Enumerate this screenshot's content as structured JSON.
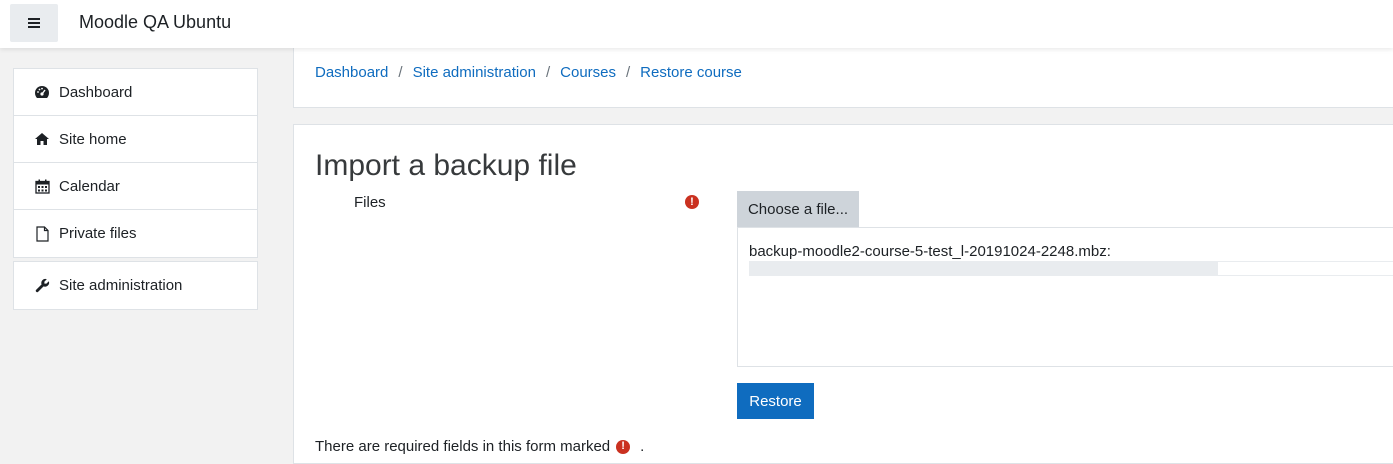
{
  "navbar": {
    "menu_icon": "hamburger-icon",
    "site_name": "Moodle QA Ubuntu"
  },
  "sidebar": {
    "items": [
      {
        "label": "Dashboard",
        "icon": "dashboard-icon"
      },
      {
        "label": "Site home",
        "icon": "home-icon"
      },
      {
        "label": "Calendar",
        "icon": "calendar-icon"
      },
      {
        "label": "Private files",
        "icon": "file-icon"
      }
    ],
    "admin": {
      "label": "Site administration",
      "icon": "wrench-icon"
    }
  },
  "breadcrumb": [
    {
      "label": "Dashboard"
    },
    {
      "label": "Site administration"
    },
    {
      "label": "Courses"
    },
    {
      "label": "Restore course"
    }
  ],
  "form": {
    "title": "Import a backup file",
    "files_label": "Files",
    "required_icon": "exclamation-icon",
    "choose_label": "Choose a file...",
    "file_name": "backup-moodle2-course-5-test_l-20191024-2248.mbz:",
    "upload_progress": 0.7,
    "restore_label": "Restore",
    "required_note": "There are required fields in this form marked",
    "required_note_end": "."
  },
  "colors": {
    "link": "#0f6cbf",
    "primary_button": "#0f6cbf",
    "required": "#ca3120",
    "background": "#f2f2f2"
  }
}
